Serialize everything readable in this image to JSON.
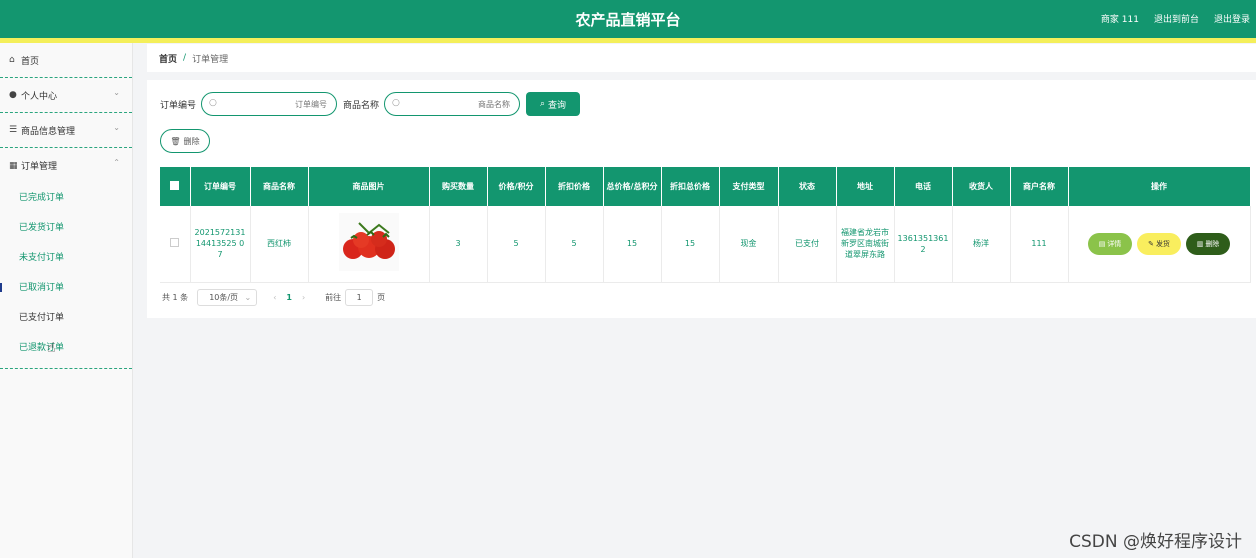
{
  "header": {
    "title": "农产品直销平台",
    "user": "商家 111",
    "back_front": "退出到前台",
    "logout": "退出登录"
  },
  "sidebar": {
    "home": "首页",
    "personal": "个人中心",
    "goods": "商品信息管理",
    "orders": "订单管理",
    "order_items": [
      "已完成订单",
      "已发货订单",
      "未支付订单",
      "已取消订单",
      "已支付订单",
      "已退款订单"
    ]
  },
  "breadcrumb": {
    "home": "首页",
    "sep": "/",
    "current": "订单管理"
  },
  "search": {
    "order_no_label": "订单编号",
    "order_no_placeholder": "订单编号",
    "goods_name_label": "商品名称",
    "goods_name_placeholder": "商品名称",
    "query_button": "查询",
    "delete_button": "删除"
  },
  "table": {
    "columns": [
      "订单编号",
      "商品名称",
      "商品图片",
      "购买数量",
      "价格/积分",
      "折扣价格",
      "总价格/总积分",
      "折扣总价格",
      "支付类型",
      "状态",
      "地址",
      "电话",
      "收货人",
      "商户名称",
      "操作"
    ],
    "rows": [
      {
        "order_no": "202157213114413525 07",
        "goods_name": "西红柿",
        "quantity": "3",
        "price": "5",
        "discount_price": "5",
        "total": "15",
        "discount_total": "15",
        "pay_type": "现金",
        "status": "已支付",
        "address": "福建省龙岩市新罗区南城街道翠屏东路",
        "phone": "13613513612",
        "receiver": "杨洋",
        "merchant": "111",
        "ops": {
          "detail": "详情",
          "ship": "发货",
          "delete": "删除"
        }
      }
    ]
  },
  "pager": {
    "total": "共 1 条",
    "size": "10条/页",
    "page": "1",
    "goto": "前往",
    "goto_value": "1",
    "page_suffix": "页"
  },
  "watermark": "CSDN @焕好程序设计"
}
